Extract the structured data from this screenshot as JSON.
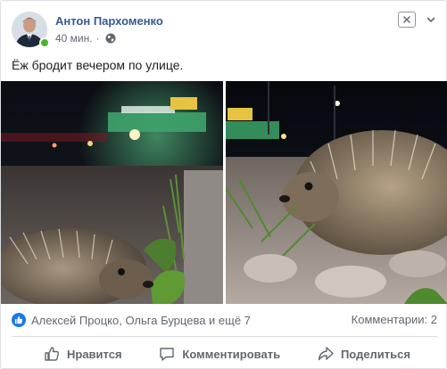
{
  "post": {
    "author": "Антон Пархоменко",
    "time": "40 мин.",
    "separator": "·",
    "text": "Ёж бродит вечером по улице.",
    "privacy_icon": "globe-icon"
  },
  "reactions": {
    "icon": "like-icon",
    "names": "Алексей Процко, Ольга Бурцева и ещё 7",
    "comments": "Комментарии: 2"
  },
  "actions": {
    "like_label": "Нравится",
    "comment_label": "Комментировать",
    "share_label": "Поделиться"
  },
  "colors": {
    "author_link": "#365899",
    "like_blue": "#1877f2",
    "online_green": "#42b72a",
    "muted_text": "#616770"
  }
}
